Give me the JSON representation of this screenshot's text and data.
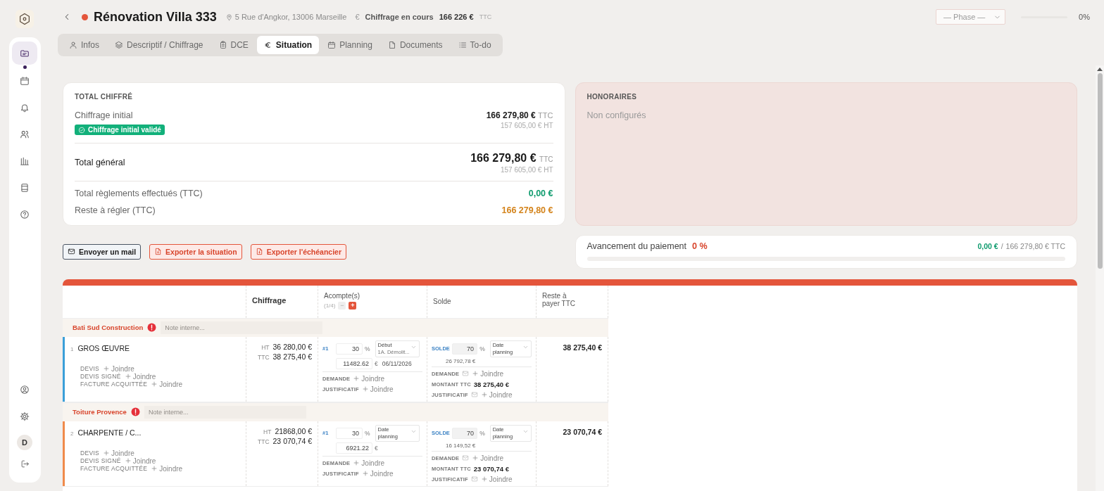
{
  "sidebar": {
    "nav": [
      {
        "kind": "folder",
        "selected": true
      },
      {
        "kind": "calendar",
        "selected": false
      },
      {
        "kind": "bell",
        "selected": false
      },
      {
        "kind": "users",
        "selected": false
      },
      {
        "kind": "chart",
        "selected": false
      },
      {
        "kind": "archive",
        "selected": false
      },
      {
        "kind": "help",
        "selected": false
      }
    ],
    "bottom": [
      {
        "kind": "user-circle"
      },
      {
        "kind": "gear"
      }
    ],
    "avatar": "D"
  },
  "header": {
    "title": "Rénovation Villa 333",
    "address": "5 Rue d'Angkor, 13006 Marseille",
    "currency_symbol": "€",
    "status_label": "Chiffrage en cours",
    "amount": "166 226 €",
    "amount_unit": "TTC",
    "phase_select": {
      "placeholder": "— Phase —"
    },
    "progress": {
      "level": 0,
      "reading": "0%"
    }
  },
  "tabs": [
    {
      "label": "Infos",
      "selected": false
    },
    {
      "label": "Descriptif / Chiffrage",
      "selected": false
    },
    {
      "label": "DCE",
      "selected": false
    },
    {
      "label": "Situation",
      "selected": true
    },
    {
      "label": "Planning",
      "selected": false
    },
    {
      "label": "Documents",
      "selected": false
    },
    {
      "label": "To-do",
      "selected": false
    }
  ],
  "total_card": {
    "title": "TOTAL CHIFFRÉ",
    "initial": {
      "label": "Chiffrage initial",
      "ttc": "166 279,80 €",
      "ttc_unit": "TTC",
      "ht": "157 605,00 € HT",
      "badge": "Chiffrage initial validé"
    },
    "general": {
      "label": "Total général",
      "ttc": "166 279,80 €",
      "ttc_unit": "TTC",
      "ht": "157 605,00 € HT"
    },
    "paid": {
      "label": "Total règlements effectués (TTC)",
      "value": "0,00 €"
    },
    "remaining": {
      "label": "Reste à régler (TTC)",
      "value": "166 279,80 €"
    }
  },
  "fees_card": {
    "title": "HONORAIRES",
    "text": "Non configurés"
  },
  "actions": [
    {
      "label": "Envoyer un mail",
      "kind": "mail"
    },
    {
      "label": "Exporter la situation",
      "kind": "export"
    },
    {
      "label": "Exporter l'échéancier",
      "kind": "export"
    }
  ],
  "payment_progress": {
    "label": "Avancement du paiement",
    "percent": "0 %",
    "paid": "0,00 €",
    "separator": "/",
    "total": "166 279,80 € TTC",
    "level": 0
  },
  "table": {
    "columns": [
      "Chiffrage",
      "Acompte(s)",
      "Solde",
      "Reste à payer TTC"
    ],
    "deposit_count": "(1/4)",
    "minus": "−",
    "plus": "+",
    "groups": [
      {
        "company": "Bati Sud Construction",
        "note_placeholder": "Note interne...",
        "lots": [
          {
            "number": "1",
            "name": "GROS ŒUVRE",
            "color": "#3b9fd8",
            "ht_label": "HT",
            "ht": "36 280,00 €",
            "ttc_label": "TTC",
            "ttc": "38 275,40 €",
            "docs": [
              {
                "label": "DEVIS",
                "action": "Joindre"
              },
              {
                "label": "DEVIS SIGNÉ",
                "action": "Joindre"
              },
              {
                "label": "FACTURE ACQUITTÉE",
                "action": "Joindre"
              }
            ],
            "deposit": {
              "tag": "#1",
              "percent": "30",
              "percent_unit": "%",
              "select": [
                "Début",
                "1A. Démolit..."
              ],
              "amount": "11482.62",
              "amount_unit": "€",
              "date": "06/11/2026",
              "request_label": "DEMANDE",
              "request_action": "Joindre",
              "proof_label": "JUSTIFICATIF",
              "proof_action": "Joindre"
            },
            "balance": {
              "tag": "SOLDE",
              "percent": "70",
              "percent_unit": "%",
              "select": [
                "Date planning"
              ],
              "amount": "26 792,78 €",
              "request_label": "DEMANDE",
              "request_action": "Joindre",
              "total_label": "MONTANT TTC",
              "total": "38 275,40 €",
              "proof_label": "JUSTIFICATIF",
              "proof_action": "Joindre"
            },
            "remaining": "38 275,40 €"
          }
        ]
      },
      {
        "company": "Toiture Provence",
        "note_placeholder": "Note interne...",
        "lots": [
          {
            "number": "2",
            "name": "CHARPENTE / C...",
            "color": "#f08a4b",
            "ht_label": "HT",
            "ht": "21868,00 €",
            "ttc_label": "TTC",
            "ttc": "23 070,74 €",
            "docs": [
              {
                "label": "DEVIS",
                "action": "Joindre"
              },
              {
                "label": "DEVIS SIGNÉ",
                "action": "Joindre"
              },
              {
                "label": "FACTURE ACQUITTÉE",
                "action": "Joindre"
              }
            ],
            "deposit": {
              "tag": "#1",
              "percent": "30",
              "percent_unit": "%",
              "select": [
                "Date planning"
              ],
              "amount": "6921.22",
              "amount_unit": "€",
              "request_label": "DEMANDE",
              "request_action": "Joindre",
              "proof_label": "JUSTIFICATIF",
              "proof_action": "Joindre"
            },
            "balance": {
              "tag": "SOLDE",
              "percent": "70",
              "percent_unit": "%",
              "select": [
                "Date planning"
              ],
              "amount": "16 149,52 €",
              "request_label": "DEMANDE",
              "request_action": "Joindre",
              "total_label": "MONTANT TTC",
              "total": "23 070,74 €",
              "proof_label": "JUSTIFICATIF",
              "proof_action": "Joindre"
            },
            "remaining": "23 070,74 €"
          }
        ]
      }
    ]
  }
}
